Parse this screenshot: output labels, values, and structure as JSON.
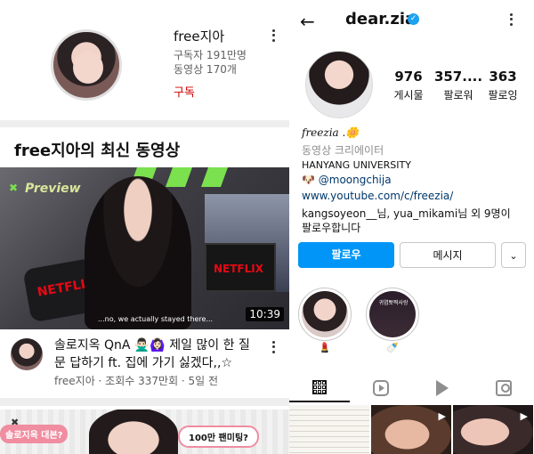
{
  "youtube": {
    "channel": {
      "name": "free지아",
      "subscribers": "구독자 191만명",
      "videos": "동영상 170개",
      "subscribe_label": "구독"
    },
    "section_title": "free지아의 최신 동영상",
    "video": {
      "thumbnail_overlay": "Preview",
      "netflix_text": "NETFLIX",
      "caption": "...no, we actually stayed there...",
      "duration": "10:39",
      "title": "솔로지옥 QnA 🙅🏻‍♂️🙆🏻‍♀️ 제일 많이 한 질문 답하기 ft. 집에 가기 싫겠다,,☆",
      "meta": "free지아 · 조회수 337만회 · 5일 전"
    },
    "next_video": {
      "pill_left": "솔로지옥 대본?",
      "pill_right": "100만 팬미팅?",
      "mark": "✖"
    }
  },
  "instagram": {
    "username": "dear.zia",
    "stats": [
      {
        "value": "976",
        "label": "게시물"
      },
      {
        "value": "357....",
        "label": "팔로워"
      },
      {
        "value": "363",
        "label": "팔로잉"
      }
    ],
    "bio": {
      "name": "freezia .🌼",
      "category": "동영상 크리에이터",
      "line1": "HANYANG UNIVERSITY",
      "line2": "🐶 @moongchija",
      "link": "www.youtube.com/c/freezia/",
      "followed_by_1": "kangsoyeon__님, yua_mikami님 외 9명이",
      "followed_by_2": "팔로우합니다"
    },
    "buttons": {
      "follow": "팔로우",
      "message": "메시지",
      "more": "⌄"
    },
    "highlights": [
      {
        "label": "💄"
      },
      {
        "label": "🍼",
        "overlay": "귀염뽀짝사랑"
      }
    ]
  },
  "colors": {
    "yt_red": "#cc0000",
    "ig_blue": "#0095f6",
    "link": "#00376b"
  }
}
